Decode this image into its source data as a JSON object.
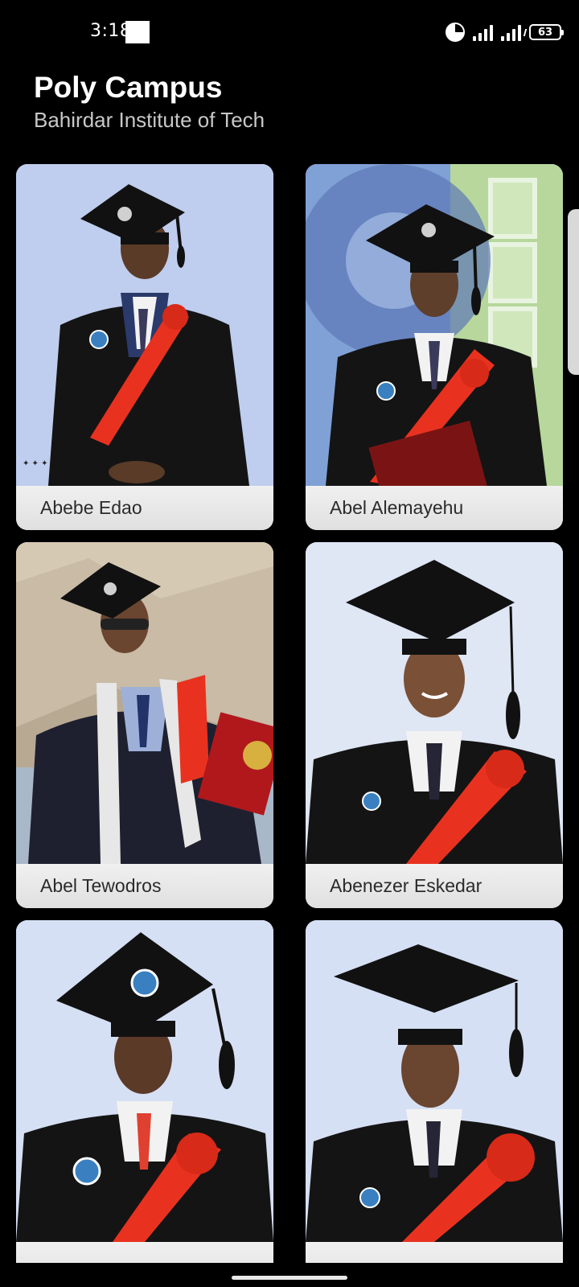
{
  "status_bar": {
    "time": "3:18",
    "battery": "63",
    "icons": [
      "data-saver-icon",
      "signal-icon",
      "signal-icon",
      "battery-icon"
    ]
  },
  "header": {
    "title": "Poly Campus",
    "subtitle": "Bahirdar Institute of Tech"
  },
  "students": [
    {
      "name": "Abebe Edao"
    },
    {
      "name": "Abel Alemayehu"
    },
    {
      "name": "Abel Tewodros"
    },
    {
      "name": "Abenezer Eskedar"
    },
    {
      "name": ""
    },
    {
      "name": ""
    }
  ],
  "colors": {
    "background": "#000000",
    "card": "#e9e9e9",
    "gown": "#141414",
    "sash": "#e8321f",
    "photo_bg": "#c9d6f0"
  }
}
